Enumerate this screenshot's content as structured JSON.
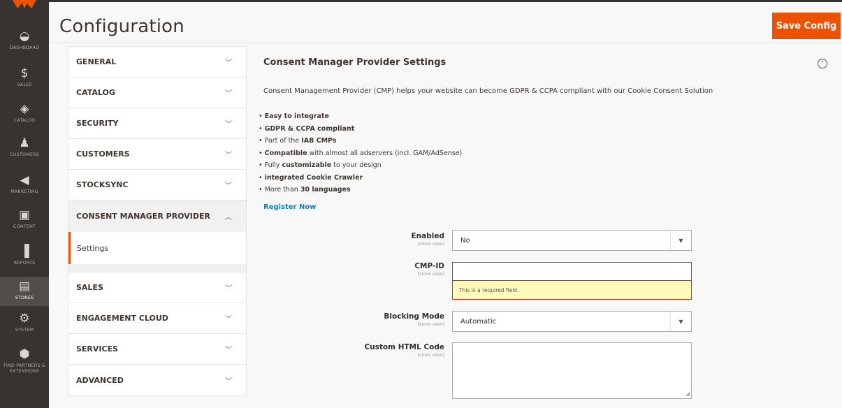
{
  "header": {
    "title": "Configuration",
    "save_label": "Save Config"
  },
  "admin_nav": [
    {
      "label": "Dashboard",
      "icon": "dashboard-icon"
    },
    {
      "label": "Sales",
      "icon": "dollar-icon"
    },
    {
      "label": "Catalog",
      "icon": "cube-icon"
    },
    {
      "label": "Customers",
      "icon": "person-icon"
    },
    {
      "label": "Marketing",
      "icon": "megaphone-icon"
    },
    {
      "label": "Content",
      "icon": "layout-icon"
    },
    {
      "label": "Reports",
      "icon": "bar-chart-icon"
    },
    {
      "label": "Stores",
      "icon": "store-icon",
      "active": true
    },
    {
      "label": "System",
      "icon": "gear-icon"
    },
    {
      "label": "Find Partners & Extensions",
      "icon": "box-icon"
    }
  ],
  "tabs": {
    "items": [
      "GENERAL",
      "CATALOG",
      "SECURITY",
      "CUSTOMERS",
      "STOCKSYNC",
      "CONSENT MANAGER PROVIDER",
      "SALES",
      "ENGAGEMENT CLOUD",
      "SERVICES",
      "ADVANCED"
    ],
    "active_sub": "Settings"
  },
  "section": {
    "title": "Consent Manager Provider Settings",
    "intro": "Consent Management Provider (CMP) helps your website can become GDPR & CCPA compliant with our Cookie Consent Solution",
    "bullets": [
      {
        "pre": "",
        "bold": "Easy to integrate",
        "post": ""
      },
      {
        "pre": "",
        "bold": "GDPR & CCPA compliant",
        "post": ""
      },
      {
        "pre": "Part of the ",
        "bold": "IAB CMPs",
        "post": ""
      },
      {
        "pre": "",
        "bold": "Compatible",
        "post": " with almost all adservers (incl. GAM/AdSense)"
      },
      {
        "pre": "Fully ",
        "bold": "customizable",
        "post": " to your design"
      },
      {
        "pre": "",
        "bold": "integrated Cookie Crawler",
        "post": ""
      },
      {
        "pre": "More than ",
        "bold": "30 languages",
        "post": ""
      }
    ],
    "register_label": "Register Now"
  },
  "fields": {
    "scope": "[store view]",
    "enabled": {
      "label": "Enabled",
      "value": "No"
    },
    "cmp_id": {
      "label": "CMP-ID",
      "value": "",
      "error": "This is a required field."
    },
    "blocking_mode": {
      "label": "Blocking Mode",
      "value": "Automatic"
    },
    "custom_html": {
      "label": "Custom HTML Code",
      "value": ""
    }
  },
  "colors": {
    "accent": "#eb5202",
    "nav_bg": "#373330",
    "link": "#1979c3",
    "error_border": "#e22626",
    "error_bg": "#fffbbb"
  }
}
